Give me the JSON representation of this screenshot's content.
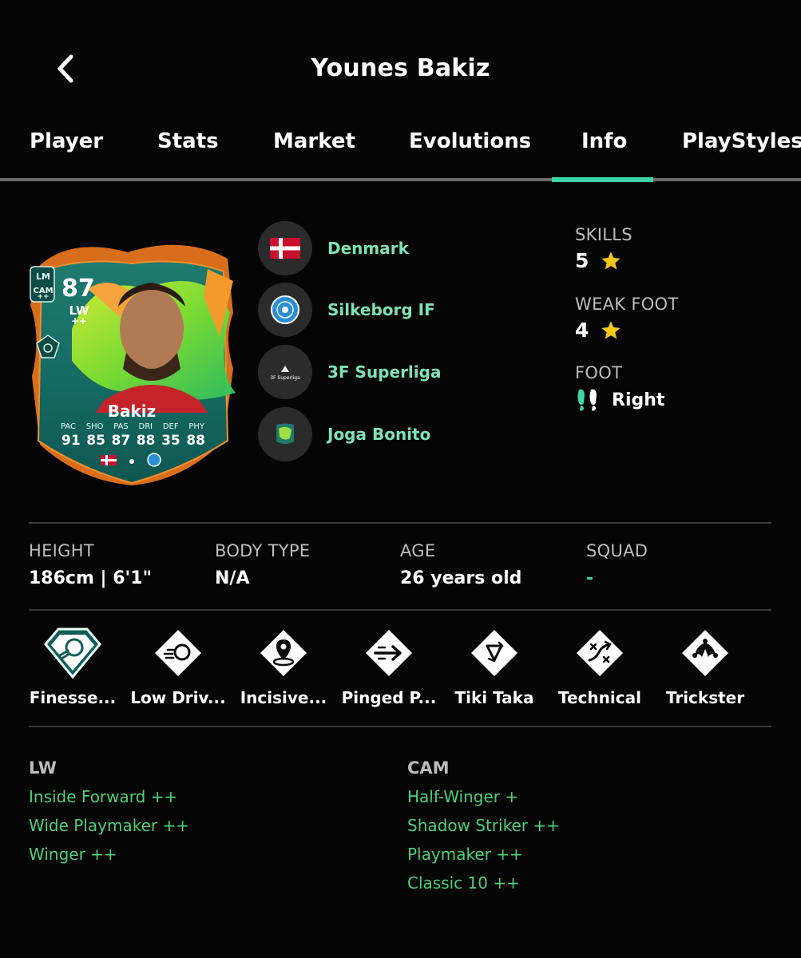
{
  "header": {
    "title": "Younes Bakiz",
    "back_icon": "chevron-left-icon"
  },
  "tabs": [
    {
      "label": "Player",
      "active": false
    },
    {
      "label": "Stats",
      "active": false
    },
    {
      "label": "Market",
      "active": false
    },
    {
      "label": "Evolutions",
      "active": false
    },
    {
      "label": "Info",
      "active": true
    },
    {
      "label": "PlayStyles",
      "active": false
    }
  ],
  "card": {
    "rating": "87",
    "position": "LW",
    "position_plus": "++",
    "alt_positions": [
      "LM",
      "CAM"
    ],
    "alt_plus": "++",
    "name": "Bakiz",
    "stat_labels": [
      "PAC",
      "SHO",
      "PAS",
      "DRI",
      "DEF",
      "PHY"
    ],
    "stat_values": [
      "91",
      "85",
      "87",
      "88",
      "35",
      "88"
    ]
  },
  "meta": {
    "nation": "Denmark",
    "club": "Silkeborg IF",
    "league": "3F Superliga",
    "league_logo_text": "3F Superliga",
    "program": "Joga Bonito"
  },
  "skills": {
    "label": "SKILLS",
    "value": "5"
  },
  "weak_foot": {
    "label": "WEAK FOOT",
    "value": "4"
  },
  "foot": {
    "label": "FOOT",
    "value": "Right"
  },
  "info": {
    "height": {
      "label": "HEIGHT",
      "value": "186cm | 6'1\""
    },
    "body_type": {
      "label": "BODY TYPE",
      "value": "N/A"
    },
    "age": {
      "label": "AGE",
      "value": "26 years old"
    },
    "squad": {
      "label": "SQUAD",
      "value": "-"
    }
  },
  "playstyles": [
    {
      "label": "Finesse...",
      "icon": "finesse-shot-plus-icon"
    },
    {
      "label": "Low Driv...",
      "icon": "low-driven-shot-icon"
    },
    {
      "label": "Incisive...",
      "icon": "incisive-pass-icon"
    },
    {
      "label": "Pinged P...",
      "icon": "pinged-pass-icon"
    },
    {
      "label": "Tiki Taka",
      "icon": "tiki-taka-icon"
    },
    {
      "label": "Technical",
      "icon": "technical-icon"
    },
    {
      "label": "Trickster",
      "icon": "trickster-icon"
    }
  ],
  "roles": {
    "lw": {
      "heading": "LW",
      "items": [
        "Inside Forward ++",
        "Wide Playmaker ++",
        "Winger ++"
      ]
    },
    "cam": {
      "heading": "CAM",
      "items": [
        "Half-Winger +",
        "Shadow Striker ++",
        "Playmaker ++",
        "Classic 10 ++"
      ]
    }
  },
  "colors": {
    "accent": "#3fd5a8",
    "role_green": "#4cd07a",
    "star": "#f5c518"
  }
}
